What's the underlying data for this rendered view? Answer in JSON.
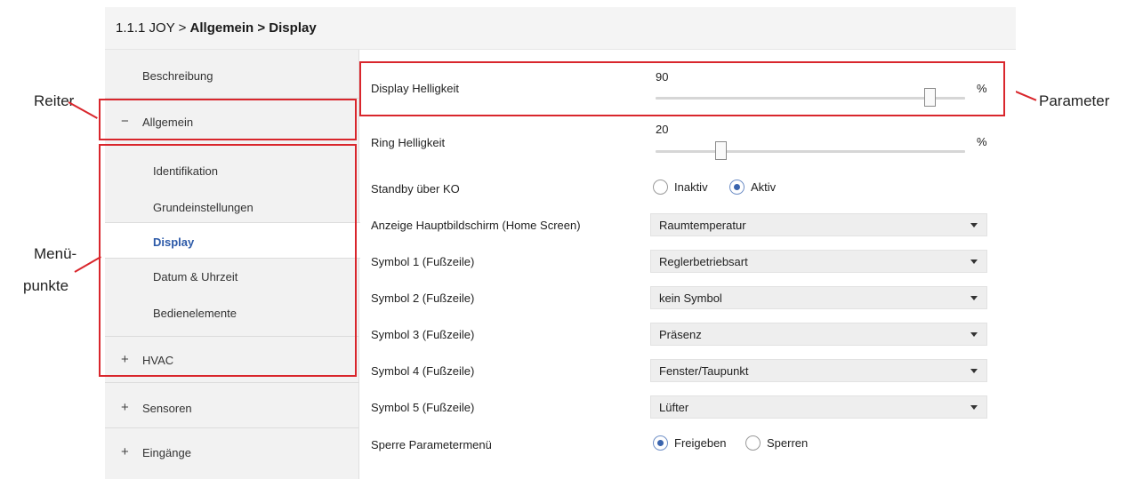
{
  "breadcrumb": {
    "prefix": "1.1.1 JOY > ",
    "bold": "Allgemein > Display"
  },
  "sidebar": {
    "top_item": "Beschreibung",
    "groups": [
      {
        "symbol": "−",
        "label": "Allgemein",
        "expanded": true
      },
      {
        "symbol": "+",
        "label": "HVAC",
        "expanded": false
      },
      {
        "symbol": "+",
        "label": "Sensoren",
        "expanded": false
      },
      {
        "symbol": "+",
        "label": "Eingänge",
        "expanded": false
      }
    ],
    "subitems": [
      "Identifikation",
      "Grundeinstellungen",
      "Display",
      "Datum & Uhrzeit",
      "Bedienelemente"
    ],
    "active_subitem": "Display"
  },
  "params": {
    "display_brightness": {
      "label": "Display Helligkeit",
      "value": "90",
      "unit": "%",
      "level_fraction": 0.9
    },
    "ring_brightness": {
      "label": "Ring Helligkeit",
      "value": "20",
      "unit": "%",
      "level_fraction": 0.2
    },
    "standby": {
      "label": "Standby über KO",
      "options": [
        "Inaktiv",
        "Aktiv"
      ],
      "selected": "Aktiv"
    },
    "home_screen": {
      "label": "Anzeige Hauptbildschirm (Home Screen)",
      "value": "Raumtemperatur"
    },
    "symbol1": {
      "label": "Symbol 1 (Fußzeile)",
      "value": "Reglerbetriebsart"
    },
    "symbol2": {
      "label": "Symbol 2 (Fußzeile)",
      "value": "kein Symbol"
    },
    "symbol3": {
      "label": "Symbol 3 (Fußzeile)",
      "value": "Präsenz"
    },
    "symbol4": {
      "label": "Symbol 4 (Fußzeile)",
      "value": "Fenster/Taupunkt"
    },
    "symbol5": {
      "label": "Symbol 5 (Fußzeile)",
      "value": "Lüfter"
    },
    "param_lock": {
      "label": "Sperre Parametermenü",
      "options": [
        "Freigeben",
        "Sperren"
      ],
      "selected": "Freigeben"
    }
  },
  "annotations": {
    "tab": "Reiter",
    "menu_line1": "Menü-",
    "menu_line2": "punkte",
    "parameter": "Parameter"
  },
  "colors": {
    "highlight_box": "#d9262c",
    "active_text": "#2d5aa8",
    "radio_selected": "#3a64ad"
  },
  "icons": {
    "expanded_group": "minus-icon",
    "collapsed_group": "plus-icon",
    "dropdown": "caret-down-icon"
  }
}
